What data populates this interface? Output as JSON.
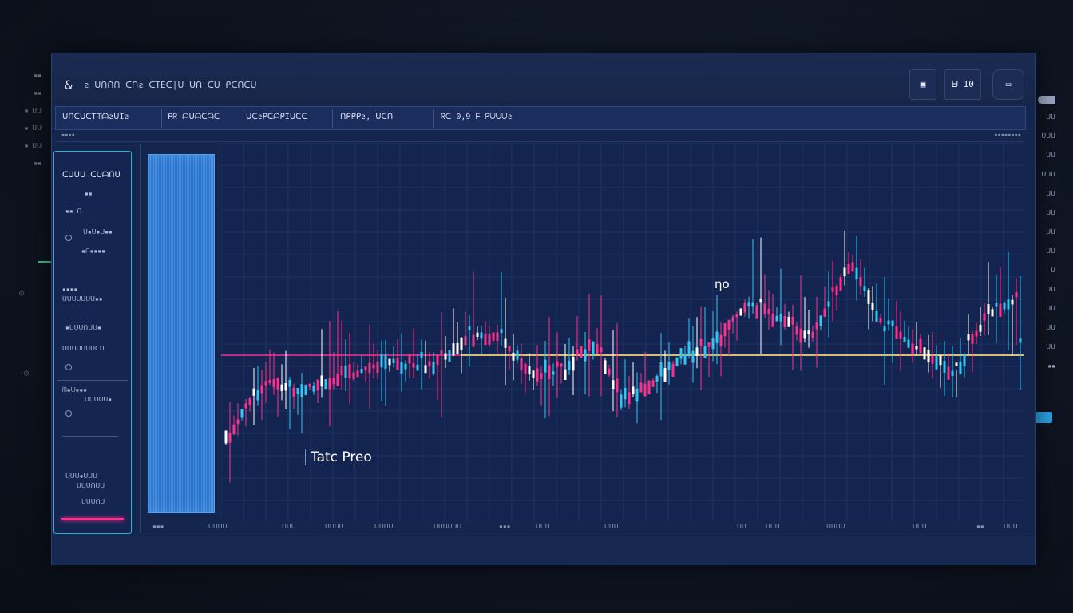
{
  "window": {
    "title_icon": "app-logo-icon",
    "title": "ƨ ᑌᑎᑎᑎ ᑕᑎƨ   ᑕTEᑕ|ᑌ ᑌᑎ   ᑕᑌ   ᑭᑕᑎᑕᑌ",
    "buttons": [
      {
        "icon": "monitor-icon",
        "label": ""
      },
      {
        "icon": "zoom-icon",
        "label": "ᗷ 10"
      },
      {
        "icon": "toggle-icon",
        "label": "▭"
      }
    ]
  },
  "menu": {
    "items": [
      "ᑌᑎᑕᑌᑕTᗰᗩƨᑌIƨ",
      "ᑭᖇ ᗩᑌᗩᑕᗩᑕ",
      "ᑌᑕƨᑭᑕᗩᑭIᑌᑕᑕ",
      "ᑎᑭᑭᑭƨ, ᑌᑕᑎ",
      "ᖇᑕ  0,9    ᖴ  ᑭᑌᑌᑌƨ"
    ]
  },
  "subbar": {
    "left": "▪▪▪▪",
    "right": "▪▪▪▪▪▪▪▪"
  },
  "sidebar": {
    "title": "ᑕᑌᑌᑌ ᑕᑌᗩᑎᑌ",
    "rows": [
      "▪▪  ᑎ",
      "ᑌ▪ᑌ▪ᑌ▪▪",
      "▪ᑎ▪▪▪▪",
      "▪▪▪▪",
      "ᑌᑌᑌᑌᑌᑌᑌ▪▪",
      "▪ᑌᑌᑌᑎᑌᑌ▪",
      "ᑌᑌᑌᑌᑌᑌᑌᑕᑌ",
      "ᗰ▪ᑌ▪▪▪",
      "ᑌᑌᑌᑌᑌ▪",
      "▪▪",
      "ᑌᑌᑌ▪ᑌᑌᑌ",
      "ᑌᑌᑌᑎᑌᑌ",
      "ᑌᑌᑌᑎᑌ"
    ]
  },
  "chart_labels": {
    "main": "Tatc Preo",
    "annotation": "ƞo"
  },
  "xaxis": [
    "▪▪▪",
    "ᑌᑌᑌᑌ",
    "ᑌᑌᑌ",
    "ᑌᑌᑌᑌ",
    "ᑌᑌᑌᑌ",
    "ᑌᑌᑌᑌᑌᑌ",
    "▪▪▪",
    "ᑌᑌᑌ",
    "ᑌᑌᑌ",
    "ᑌᑌ",
    "ᑌᑌᑌ",
    "ᑌᑌᑌᑌ",
    "ᑌᑌᑌ",
    "▪▪",
    "ᑌᑌᑌ"
  ],
  "margin_left": [
    "▪▪",
    "▪▪",
    "▪ ᑌᑌ",
    "▪ ᑌᑌ",
    "▪ ᑌᑌ",
    "▪▪"
  ],
  "margin_right": [
    "▪▪▪",
    "ᑌᑌ",
    "ᑌᑌᑌ",
    "ᑌᑌ",
    "ᑌᑌᑌ",
    "ᑌᑌ",
    "ᑌᑌ",
    "ᑌᑌ",
    "ᑌᑌ",
    "ᑌ",
    "ᑌᑌ",
    "ᑌᑌ",
    "ᑌᑌ",
    "ᑌᑌ",
    "▪▪"
  ],
  "colors": {
    "background": "#0e1420",
    "panel": "#15264e",
    "chart_bg": "#132450",
    "up": "#33c6f2",
    "down": "#ff2f8e",
    "neutral": "#ffffff",
    "yellow_line": "#f4f06a",
    "pink_line": "#ff2f8e",
    "orange_line": "#ff6a4a"
  }
}
